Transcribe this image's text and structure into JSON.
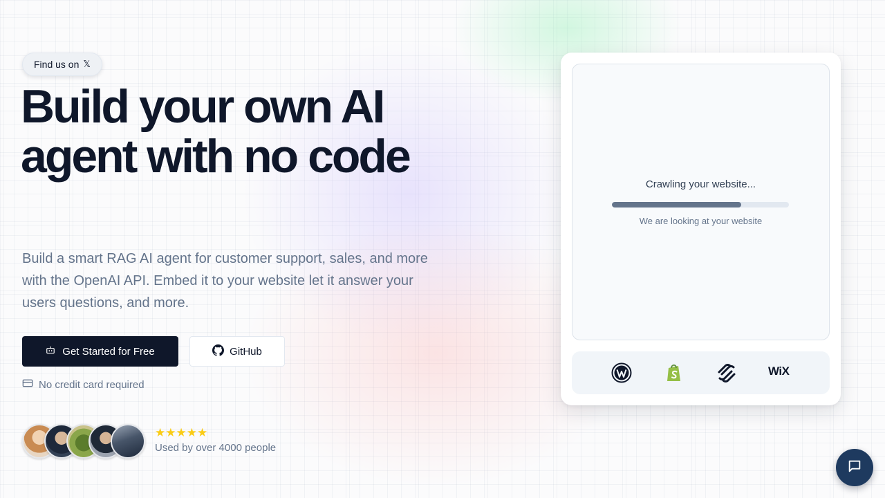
{
  "hero": {
    "badge_label": "Find us on",
    "badge_icon": "x-logo-icon",
    "badge_glyph": "𝕏",
    "headline": "Build your own AI agent with no code",
    "subheadline": "Build a smart RAG AI agent for customer support, sales, and more with the OpenAI API. Embed it to your website let it answer your users questions, and more.",
    "primary_cta": "Get Started for Free",
    "secondary_cta": "GitHub",
    "note": "No credit card required"
  },
  "social_proof": {
    "stars": "★★★★★",
    "rating": 5,
    "text": "Used by over 4000 people",
    "avatar_count": 5
  },
  "crawler": {
    "title": "Crawling your website...",
    "subtitle": "We are looking at your website",
    "progress": 0.73
  },
  "platforms": {
    "items": [
      "wordpress-icon",
      "shopify-icon",
      "squarespace-icon",
      "wix-logo"
    ],
    "wix_label": "WiX"
  },
  "colors": {
    "primary": "#0f172a",
    "muted_text": "#64748b",
    "chat_button": "#1e3a5f",
    "star": "#facc15",
    "shopify_green": "#95bf47"
  }
}
